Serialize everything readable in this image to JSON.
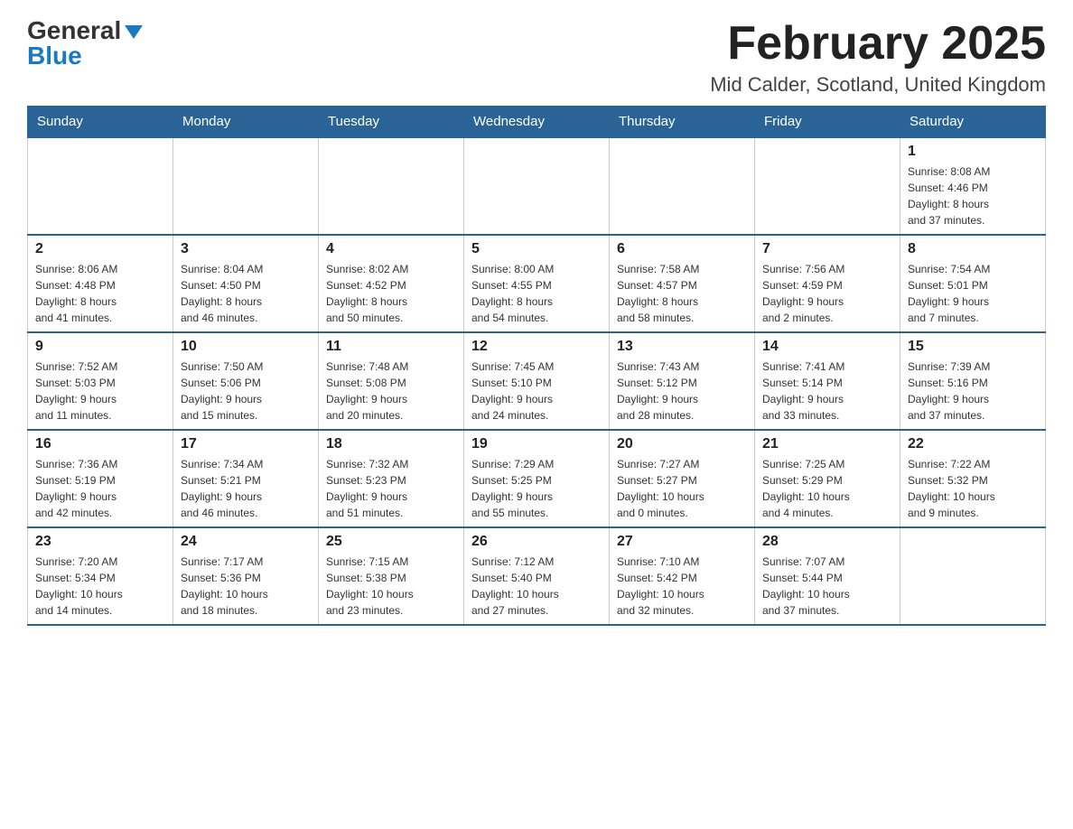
{
  "header": {
    "logo_general": "General",
    "logo_blue": "Blue",
    "month_title": "February 2025",
    "location": "Mid Calder, Scotland, United Kingdom"
  },
  "days_of_week": [
    "Sunday",
    "Monday",
    "Tuesday",
    "Wednesday",
    "Thursday",
    "Friday",
    "Saturday"
  ],
  "weeks": [
    {
      "days": [
        {
          "number": "",
          "info": ""
        },
        {
          "number": "",
          "info": ""
        },
        {
          "number": "",
          "info": ""
        },
        {
          "number": "",
          "info": ""
        },
        {
          "number": "",
          "info": ""
        },
        {
          "number": "",
          "info": ""
        },
        {
          "number": "1",
          "info": "Sunrise: 8:08 AM\nSunset: 4:46 PM\nDaylight: 8 hours\nand 37 minutes."
        }
      ]
    },
    {
      "days": [
        {
          "number": "2",
          "info": "Sunrise: 8:06 AM\nSunset: 4:48 PM\nDaylight: 8 hours\nand 41 minutes."
        },
        {
          "number": "3",
          "info": "Sunrise: 8:04 AM\nSunset: 4:50 PM\nDaylight: 8 hours\nand 46 minutes."
        },
        {
          "number": "4",
          "info": "Sunrise: 8:02 AM\nSunset: 4:52 PM\nDaylight: 8 hours\nand 50 minutes."
        },
        {
          "number": "5",
          "info": "Sunrise: 8:00 AM\nSunset: 4:55 PM\nDaylight: 8 hours\nand 54 minutes."
        },
        {
          "number": "6",
          "info": "Sunrise: 7:58 AM\nSunset: 4:57 PM\nDaylight: 8 hours\nand 58 minutes."
        },
        {
          "number": "7",
          "info": "Sunrise: 7:56 AM\nSunset: 4:59 PM\nDaylight: 9 hours\nand 2 minutes."
        },
        {
          "number": "8",
          "info": "Sunrise: 7:54 AM\nSunset: 5:01 PM\nDaylight: 9 hours\nand 7 minutes."
        }
      ]
    },
    {
      "days": [
        {
          "number": "9",
          "info": "Sunrise: 7:52 AM\nSunset: 5:03 PM\nDaylight: 9 hours\nand 11 minutes."
        },
        {
          "number": "10",
          "info": "Sunrise: 7:50 AM\nSunset: 5:06 PM\nDaylight: 9 hours\nand 15 minutes."
        },
        {
          "number": "11",
          "info": "Sunrise: 7:48 AM\nSunset: 5:08 PM\nDaylight: 9 hours\nand 20 minutes."
        },
        {
          "number": "12",
          "info": "Sunrise: 7:45 AM\nSunset: 5:10 PM\nDaylight: 9 hours\nand 24 minutes."
        },
        {
          "number": "13",
          "info": "Sunrise: 7:43 AM\nSunset: 5:12 PM\nDaylight: 9 hours\nand 28 minutes."
        },
        {
          "number": "14",
          "info": "Sunrise: 7:41 AM\nSunset: 5:14 PM\nDaylight: 9 hours\nand 33 minutes."
        },
        {
          "number": "15",
          "info": "Sunrise: 7:39 AM\nSunset: 5:16 PM\nDaylight: 9 hours\nand 37 minutes."
        }
      ]
    },
    {
      "days": [
        {
          "number": "16",
          "info": "Sunrise: 7:36 AM\nSunset: 5:19 PM\nDaylight: 9 hours\nand 42 minutes."
        },
        {
          "number": "17",
          "info": "Sunrise: 7:34 AM\nSunset: 5:21 PM\nDaylight: 9 hours\nand 46 minutes."
        },
        {
          "number": "18",
          "info": "Sunrise: 7:32 AM\nSunset: 5:23 PM\nDaylight: 9 hours\nand 51 minutes."
        },
        {
          "number": "19",
          "info": "Sunrise: 7:29 AM\nSunset: 5:25 PM\nDaylight: 9 hours\nand 55 minutes."
        },
        {
          "number": "20",
          "info": "Sunrise: 7:27 AM\nSunset: 5:27 PM\nDaylight: 10 hours\nand 0 minutes."
        },
        {
          "number": "21",
          "info": "Sunrise: 7:25 AM\nSunset: 5:29 PM\nDaylight: 10 hours\nand 4 minutes."
        },
        {
          "number": "22",
          "info": "Sunrise: 7:22 AM\nSunset: 5:32 PM\nDaylight: 10 hours\nand 9 minutes."
        }
      ]
    },
    {
      "days": [
        {
          "number": "23",
          "info": "Sunrise: 7:20 AM\nSunset: 5:34 PM\nDaylight: 10 hours\nand 14 minutes."
        },
        {
          "number": "24",
          "info": "Sunrise: 7:17 AM\nSunset: 5:36 PM\nDaylight: 10 hours\nand 18 minutes."
        },
        {
          "number": "25",
          "info": "Sunrise: 7:15 AM\nSunset: 5:38 PM\nDaylight: 10 hours\nand 23 minutes."
        },
        {
          "number": "26",
          "info": "Sunrise: 7:12 AM\nSunset: 5:40 PM\nDaylight: 10 hours\nand 27 minutes."
        },
        {
          "number": "27",
          "info": "Sunrise: 7:10 AM\nSunset: 5:42 PM\nDaylight: 10 hours\nand 32 minutes."
        },
        {
          "number": "28",
          "info": "Sunrise: 7:07 AM\nSunset: 5:44 PM\nDaylight: 10 hours\nand 37 minutes."
        },
        {
          "number": "",
          "info": ""
        }
      ]
    }
  ]
}
